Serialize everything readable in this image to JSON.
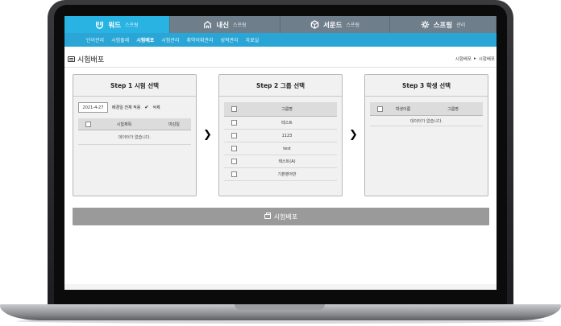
{
  "topnav": [
    {
      "main": "워드",
      "sub": "스프링",
      "icon": "words-logo-icon"
    },
    {
      "main": "내신",
      "sub": "스프링",
      "icon": "school-icon"
    },
    {
      "main": "서운드",
      "sub": "스프링",
      "icon": "cube-icon"
    },
    {
      "main": "스프링",
      "sub": "관리",
      "icon": "gear-icon"
    }
  ],
  "subnav": [
    "단어관리",
    "시험출제",
    "시험배포",
    "시험관리",
    "취약어휘관리",
    "성적관리",
    "자료실"
  ],
  "subnav_active": "시험배포",
  "page": {
    "title": "시험배포",
    "breadcrumb": [
      "시험배포",
      "시험배포"
    ]
  },
  "step1": {
    "title": "Step 1 시험 선택",
    "date": "2021-4-27",
    "filter_label": "배경일 전체 적용",
    "check_label": "삭제",
    "col_name": "시험제목",
    "col_date": "마감일",
    "empty": "데이터가 없습니다."
  },
  "step2": {
    "title": "Step 2 그룹 선택",
    "col_group": "그룹명",
    "groups": [
      "테스트",
      "1123",
      "test",
      "테스트(A)",
      "기본영어반"
    ]
  },
  "step3": {
    "title": "Step 3 학생 선택",
    "col_student": "학생이름",
    "col_group": "그룹명",
    "empty": "데이터가 없습니다."
  },
  "submit_label": "시험배포",
  "colors": {
    "accent": "#29b3e3",
    "subnav": "#2aa6d6",
    "nav": "#6f7e8b",
    "button": "#9a9a9a"
  }
}
